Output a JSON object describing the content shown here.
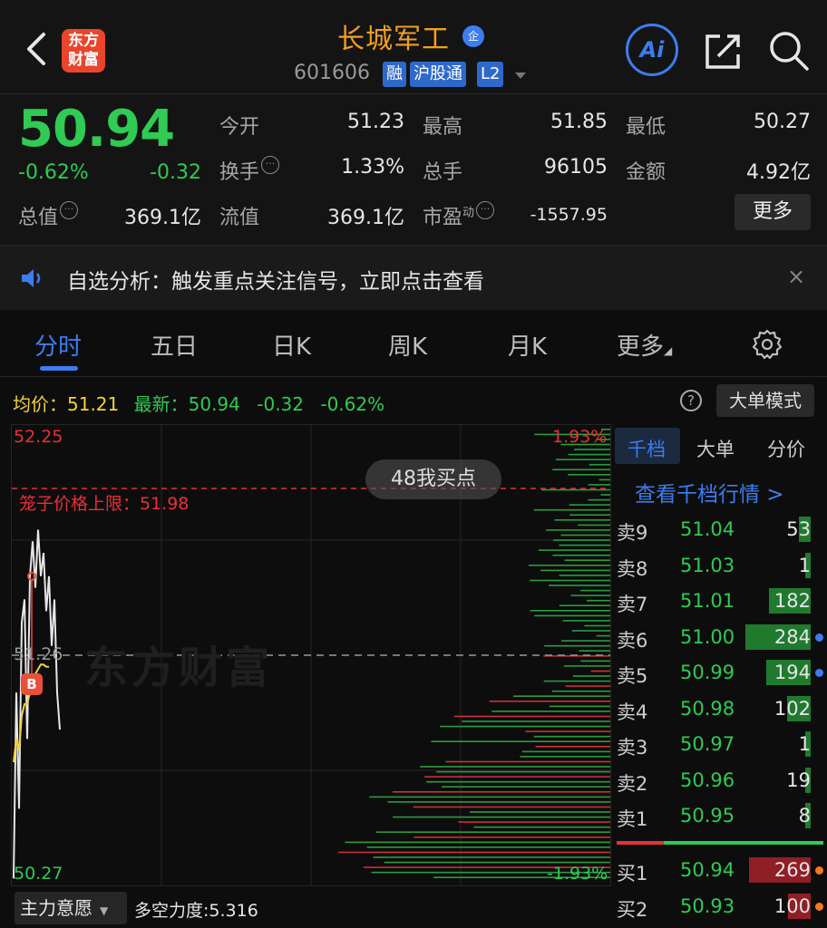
{
  "header": {
    "logo_line1": "东方",
    "logo_line2": "财富",
    "stock_name": "长城军工",
    "qi_badge": "企",
    "stock_code": "601606",
    "tags": [
      "融",
      "沪股通",
      "L2"
    ],
    "ai_label": "Ai"
  },
  "quote": {
    "price": "50.94",
    "change_pct": "-0.62%",
    "change": "-0.32",
    "open_label": "今开",
    "open": "51.23",
    "high_label": "最高",
    "high": "51.85",
    "low_label": "最低",
    "low": "50.27",
    "turnover_label": "换手",
    "turnover": "1.33%",
    "volume_label": "总手",
    "volume": "96105",
    "amount_label": "金额",
    "amount": "4.92亿",
    "mktcap_label": "总值",
    "mktcap": "369.1亿",
    "float_label": "流值",
    "float": "369.1亿",
    "pe_label": "市盈",
    "pe_sup": "动",
    "pe": "-1557.95",
    "more_label": "更多"
  },
  "notice": {
    "text": "自选分析：触发重点关注信号，立即点击查看",
    "close": "×"
  },
  "tabs": [
    {
      "label": "分时",
      "active": true
    },
    {
      "label": "五日"
    },
    {
      "label": "日K"
    },
    {
      "label": "周K"
    },
    {
      "label": "月K"
    },
    {
      "label": "更多"
    }
  ],
  "indicator": {
    "avg_label": "均价：",
    "avg": "51.21",
    "latest_label": "最新：",
    "latest": "50.94",
    "chg": "-0.32",
    "chg_pct": "-0.62%",
    "help": "?",
    "mode_button": "大单模式"
  },
  "chart": {
    "top_price": "52.25",
    "top_pct": "1.93%",
    "bottom_price": "50.27",
    "bottom_pct": "-1.93%",
    "mid_price": "51.26",
    "cage_limit": "笼子价格上限：51.98",
    "overlay_text": "48我买点",
    "watermark": "东方财富",
    "buy_marker": "B"
  },
  "chart_data": {
    "type": "line",
    "ylim": [
      50.27,
      52.25
    ],
    "reference_price": 51.26,
    "cage_upper_limit": 51.98,
    "series": [
      {
        "values": [
          50.3,
          51.1,
          50.6,
          51.4,
          51.5,
          50.9,
          51.6,
          51.75,
          51.55,
          51.8,
          51.6,
          51.7,
          51.45,
          51.6,
          51.3,
          51.5,
          51.1,
          50.94
        ]
      },
      {
        "values": [
          50.8,
          50.9,
          50.85,
          51.0,
          51.05,
          51.05,
          51.1,
          51.15,
          51.18,
          51.2,
          51.22,
          51.22,
          51.21,
          51.21
        ]
      }
    ]
  },
  "order_book": {
    "tabs": [
      "千档",
      "大单",
      "分价"
    ],
    "link": "查看千档行情 >",
    "asks": [
      {
        "label": "卖9",
        "price": "51.04",
        "vol": "53"
      },
      {
        "label": "卖8",
        "price": "51.03",
        "vol": "1"
      },
      {
        "label": "卖7",
        "price": "51.01",
        "vol": "182"
      },
      {
        "label": "卖6",
        "price": "51.00",
        "vol": "284"
      },
      {
        "label": "卖5",
        "price": "50.99",
        "vol": "194"
      },
      {
        "label": "卖4",
        "price": "50.98",
        "vol": "102"
      },
      {
        "label": "卖3",
        "price": "50.97",
        "vol": "1"
      },
      {
        "label": "卖2",
        "price": "50.96",
        "vol": "19"
      },
      {
        "label": "卖1",
        "price": "50.95",
        "vol": "8"
      }
    ],
    "bids": [
      {
        "label": "买1",
        "price": "50.94",
        "vol": "269"
      },
      {
        "label": "买2",
        "price": "50.93",
        "vol": "100"
      }
    ]
  },
  "bottom": {
    "select": "主力意愿",
    "strength": "多空力度:5.316"
  }
}
